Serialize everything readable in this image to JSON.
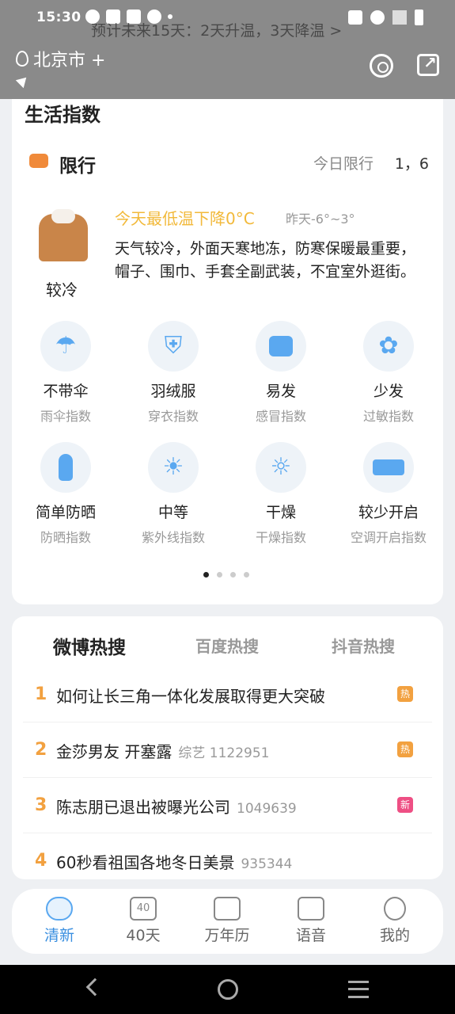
{
  "status_bar": {
    "time": "15:30"
  },
  "top": {
    "forecast_marquee": "预计未来15天：2天升温，3天降温  >",
    "city": "北京市 +"
  },
  "life_index": {
    "title": "生活指数",
    "limit": {
      "label": "限行",
      "sub": "今日限行",
      "numbers": "1，6"
    },
    "temp_note": "今天最低温下降0°C",
    "yesterday": "昨天-6°~3°",
    "cold_level": "较冷",
    "advice": "天气较冷，外面天寒地冻，防寒保暖最重要，帽子、围巾、手套全副武装，不宜室外逛街。",
    "items": [
      {
        "value": "不带伞",
        "name": "雨伞指数",
        "icon": "umbrella-icon"
      },
      {
        "value": "羽绒服",
        "name": "穿衣指数",
        "icon": "down-jacket-icon"
      },
      {
        "value": "易发",
        "name": "感冒指数",
        "icon": "medical-kit-icon"
      },
      {
        "value": "少发",
        "name": "过敏指数",
        "icon": "flower-icon"
      },
      {
        "value": "简单防晒",
        "name": "防晒指数",
        "icon": "sunscreen-icon"
      },
      {
        "value": "中等",
        "name": "紫外线指数",
        "icon": "sun-icon"
      },
      {
        "value": "干燥",
        "name": "干燥指数",
        "icon": "sun-cloud-icon"
      },
      {
        "value": "较少开启",
        "name": "空调开启指数",
        "icon": "air-conditioner-icon"
      }
    ]
  },
  "hot": {
    "tabs": [
      "微博热搜",
      "百度热搜",
      "抖音热搜"
    ],
    "rows": [
      {
        "rank": "1",
        "title": "如何让长三角一体化发展取得更大突破",
        "meta": "",
        "badge": "热",
        "badge_color": "#f2a140"
      },
      {
        "rank": "2",
        "title": "金莎男友 开塞露",
        "meta": "综艺 1122951",
        "badge": "热",
        "badge_color": "#f2a140"
      },
      {
        "rank": "3",
        "title": "陈志朋已退出被曝光公司",
        "meta": "1049639",
        "badge": "新",
        "badge_color": "#ee4f84"
      },
      {
        "rank": "4",
        "title": "60秒看祖国各地冬日美景",
        "meta": "935344",
        "badge": "",
        "badge_color": ""
      }
    ]
  },
  "bottom_nav": [
    {
      "label": "清新",
      "icon": "weather-cloud-icon",
      "active": true,
      "badge": ""
    },
    {
      "label": "40天",
      "icon": "forty-days-icon",
      "active": false,
      "badge": "40"
    },
    {
      "label": "万年历",
      "icon": "calendar-icon",
      "active": false,
      "badge": ""
    },
    {
      "label": "语音",
      "icon": "speaker-icon",
      "active": false,
      "badge": ""
    },
    {
      "label": "我的",
      "icon": "profile-icon",
      "active": false,
      "badge": ""
    }
  ]
}
